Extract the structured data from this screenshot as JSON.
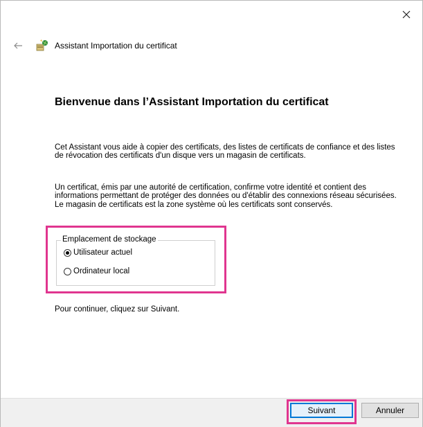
{
  "window": {
    "title": "Assistant Importation du certificat"
  },
  "icons": {
    "close": "close-icon",
    "back": "back-arrow-icon",
    "wizard": "certificate-wizard-icon"
  },
  "content": {
    "heading": "Bienvenue dans l’Assistant Importation du certificat",
    "paragraph1": "Cet Assistant vous aide à copier des certificats, des listes de certificats de confiance et des listes de révocation des certificats d'un disque vers un magasin de certificats.",
    "paragraph2": "Un certificat, émis par une autorité de certification, confirme votre identité et contient des informations permettant de protéger des données ou d'établir des connexions réseau sécurisées. Le magasin de certificats est la zone système où les certificats sont conservés.",
    "storage_group": {
      "legend": "Emplacement de stockage",
      "options": [
        {
          "label": "Utilisateur actuel",
          "checked": true
        },
        {
          "label": "Ordinateur local",
          "checked": false
        }
      ]
    },
    "continue_text": "Pour continuer, cliquez sur Suivant."
  },
  "buttons": {
    "next": "Suivant",
    "cancel": "Annuler"
  },
  "colors": {
    "highlight": "#e0358f",
    "focus": "#0078d7"
  }
}
